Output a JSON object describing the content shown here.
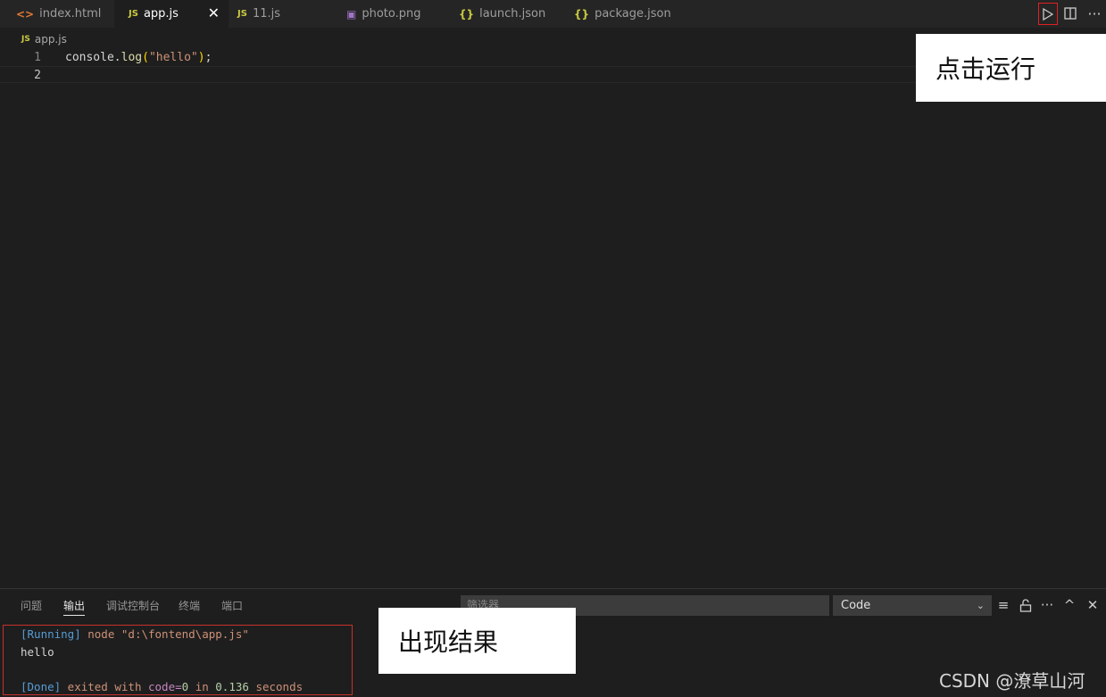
{
  "tabs": [
    {
      "icon": "<>",
      "label": "index.html",
      "type": "html"
    },
    {
      "icon": "JS",
      "label": "app.js",
      "type": "js",
      "active": true
    },
    {
      "icon": "JS",
      "label": "11.js",
      "type": "js"
    },
    {
      "icon": "▣",
      "label": "photo.png",
      "type": "img"
    },
    {
      "icon": "{}",
      "label": "launch.json",
      "type": "json"
    },
    {
      "icon": "{}",
      "label": "package.json",
      "type": "json"
    }
  ],
  "tab_close": "✕",
  "editor_actions": {
    "run": "run-icon",
    "split": "split-editor-icon",
    "more": "···"
  },
  "breadcrumb": {
    "icon": "JS",
    "file": "app.js"
  },
  "editor": {
    "lines": [
      {
        "number": "1",
        "tokens": {
          "obj": "console.",
          "fn": "log",
          "open": "(",
          "str": "\"hello\"",
          "close": ")",
          "end": ";"
        }
      },
      {
        "number": "2"
      }
    ]
  },
  "annotations": {
    "run_hint": "点击运行",
    "result_hint": "出现结果"
  },
  "panel": {
    "tabs": [
      "问题",
      "输出",
      "调试控制台",
      "终端",
      "端口"
    ],
    "active_tab": "输出",
    "filter_placeholder": "筛选器",
    "channel": "Code",
    "icons": {
      "chevron": "⌄",
      "clear": "≡",
      "lock": "🔓",
      "more": "···",
      "maximize": "^",
      "close": "✕"
    },
    "output": {
      "running_tag": "[Running]",
      "running_cmd": " node \"d:\\fontend\\app.js\"",
      "result": "hello",
      "done_tag": "[Done]",
      "done_text": " exited with ",
      "done_code": "code=",
      "done_code_val": "0",
      "done_in": " in ",
      "done_time": "0.136",
      "done_unit": " seconds"
    }
  },
  "watermark": "CSDN @潦草山河",
  "colors": {
    "accent_red": "#e02020",
    "editor_bg": "#1e1e1e",
    "tabbar_bg": "#252526"
  }
}
